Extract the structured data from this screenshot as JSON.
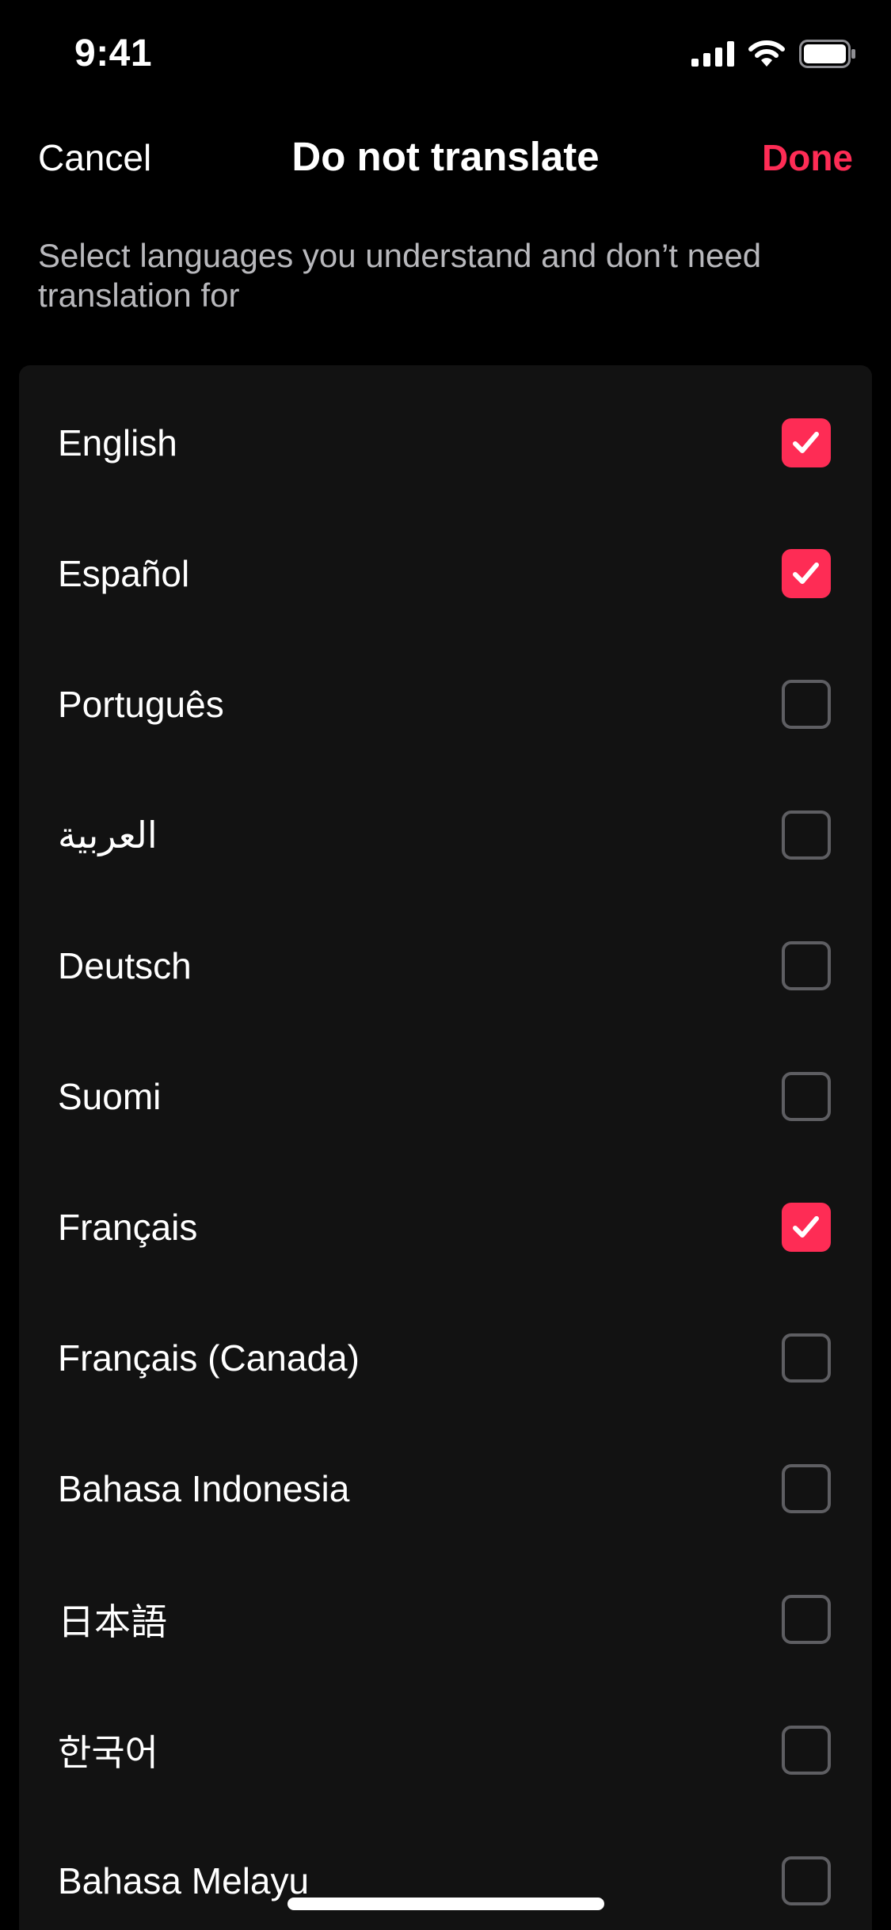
{
  "status_bar": {
    "time": "9:41",
    "icons": [
      "cellular-signal-icon",
      "wifi-icon",
      "battery-icon"
    ]
  },
  "nav": {
    "cancel_label": "Cancel",
    "title": "Do not translate",
    "done_label": "Done"
  },
  "subtitle": "Select languages you understand and don’t need translation for",
  "colors": {
    "accent": "#fe2c55",
    "background": "#000000",
    "card": "#121212",
    "unchecked_border": "#5e5e62",
    "subtitle_text": "#b8b8bc"
  },
  "languages": [
    {
      "label": "English",
      "checked": true
    },
    {
      "label": "Español",
      "checked": true
    },
    {
      "label": "Português",
      "checked": false
    },
    {
      "label": "العربية",
      "checked": false
    },
    {
      "label": "Deutsch",
      "checked": false
    },
    {
      "label": "Suomi",
      "checked": false
    },
    {
      "label": "Français",
      "checked": true
    },
    {
      "label": "Français (Canada)",
      "checked": false
    },
    {
      "label": "Bahasa Indonesia",
      "checked": false
    },
    {
      "label": "日本語",
      "checked": false
    },
    {
      "label": "한국어",
      "checked": false
    },
    {
      "label": "Bahasa Melayu",
      "checked": false
    }
  ]
}
